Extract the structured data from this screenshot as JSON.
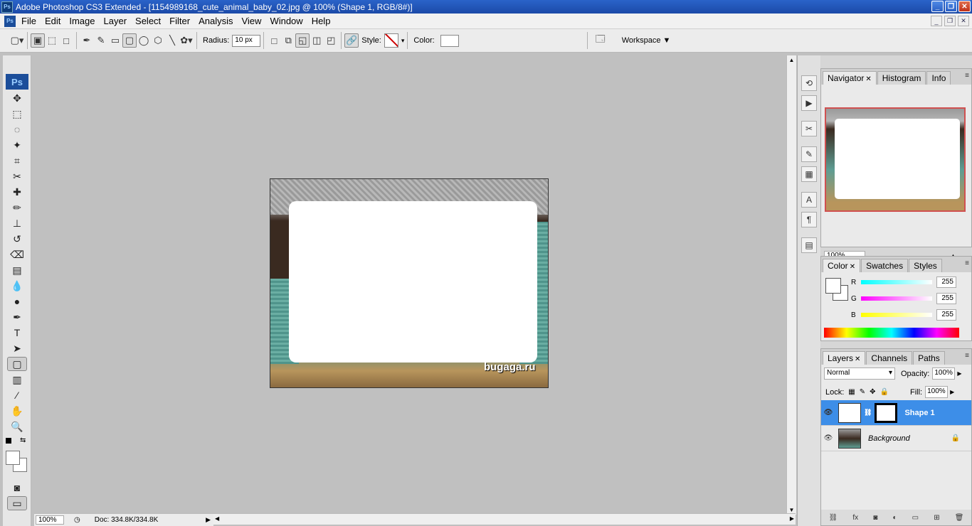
{
  "window": {
    "title": "Adobe Photoshop CS3 Extended - [1154989168_cute_animal_baby_02.jpg @ 100% (Shape 1, RGB/8#)]",
    "app_icon": "Ps"
  },
  "menu": [
    "File",
    "Edit",
    "Image",
    "Layer",
    "Select",
    "Filter",
    "Analysis",
    "View",
    "Window",
    "Help"
  ],
  "options": {
    "radius_label": "Radius:",
    "radius_value": "10 px",
    "style_label": "Style:",
    "color_label": "Color:",
    "workspace": "Workspace ▼"
  },
  "toolbox": {
    "logo": "Ps"
  },
  "document": {
    "watermark": "bugaga.ru"
  },
  "status": {
    "zoom": "100%",
    "doc": "Doc: 334.8K/334.8K"
  },
  "navigator": {
    "tabs": [
      "Navigator",
      "Histogram",
      "Info"
    ],
    "zoom": "100%"
  },
  "color": {
    "tabs": [
      "Color",
      "Swatches",
      "Styles"
    ],
    "r_label": "R",
    "g_label": "G",
    "b_label": "B",
    "r": "255",
    "g": "255",
    "b": "255"
  },
  "layers": {
    "tabs": [
      "Layers",
      "Channels",
      "Paths"
    ],
    "blend": "Normal",
    "opacity_label": "Opacity:",
    "opacity": "100%",
    "lock_label": "Lock:",
    "fill_label": "Fill:",
    "fill": "100%",
    "items": [
      {
        "name": "Shape 1"
      },
      {
        "name": "Background"
      }
    ]
  }
}
